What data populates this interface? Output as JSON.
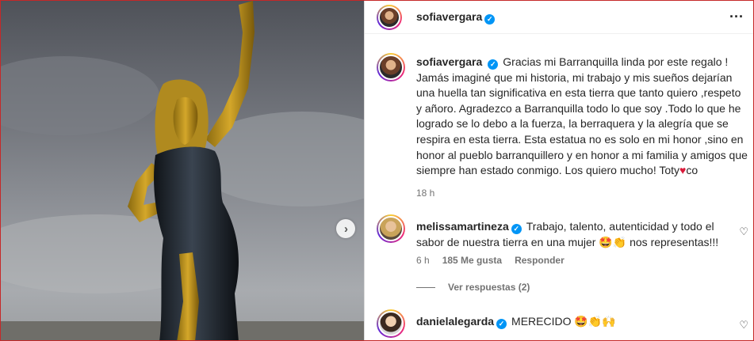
{
  "header": {
    "username": "sofiavergara",
    "more_icon": "more-options-icon"
  },
  "caption": {
    "username": "sofiavergara",
    "text": "Gracias mi Barranquilla linda por este regalo ! Jamás imaginé que mi historia, mi trabajo y mis sueños dejarían una huella tan significativa en esta tierra que tanto quiero ,respeto y añoro. Agradezco a Barranquilla todo lo que soy .Todo lo que he logrado se lo debo a la fuerza, la berraquera y la alegría que se respira en esta tierra. Esta estatua no es solo en mi honor ,sino en honor al pueblo barranquillero y en honor a mi familia y amigos que siempre han estado conmigo. Los quiero mucho! Toty",
    "text_end": "co",
    "time": "18 h"
  },
  "comments": [
    {
      "username": "melissamartineza",
      "text": "Trabajo, talento, autenticidad y todo el sabor de nuestra tierra en una mujer 🤩👏 nos representas!!!",
      "time": "6 h",
      "likes": "185 Me gusta",
      "reply": "Responder",
      "view_replies": "Ver respuestas (2)"
    },
    {
      "username": "danielalegarda",
      "text": "MERECIDO 🤩👏🙌"
    }
  ],
  "colors": {
    "accent": "#0095f6",
    "heart": "#d91b3a",
    "border": "#c62828"
  }
}
